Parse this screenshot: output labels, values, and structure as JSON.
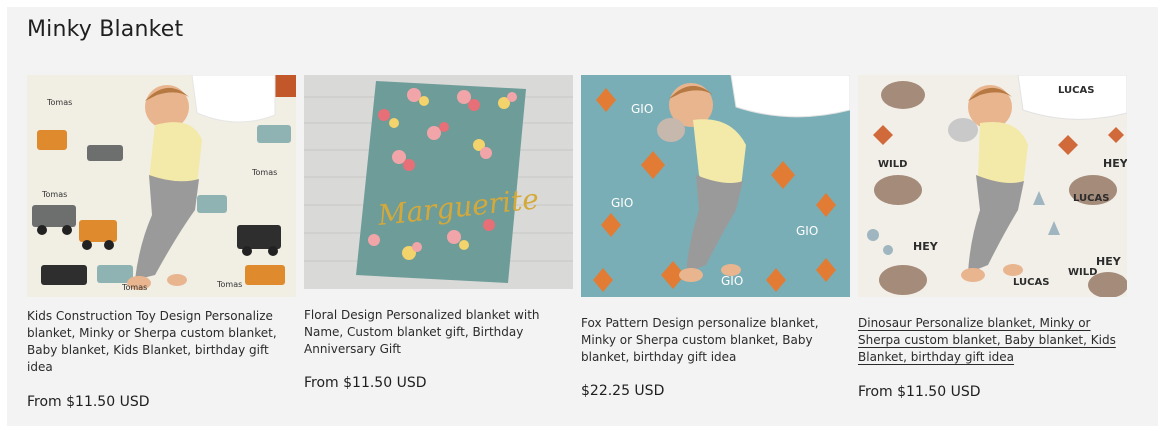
{
  "section": {
    "title": "Minky Blanket"
  },
  "products": [
    {
      "image_alt": "Kids Construction Toy Design blanket with sleeping boy",
      "title": "Kids Construction Toy Design Personalize blanket, Minky or Sherpa custom blanket, Baby blanket, Kids Blanket, birthday gift idea",
      "price": "From $11.50 USD",
      "pattern_name": "Tomas"
    },
    {
      "image_alt": "Floral Design blanket with name on wooden floor",
      "title": "Floral Design Personalized blanket with Name, Custom blanket gift, Birthday Anniversary Gift",
      "price": "From $11.50 USD",
      "pattern_name": "Marguerite"
    },
    {
      "image_alt": "Fox Pattern Design blanket with sleeping boy",
      "title": "Fox Pattern Design personalize blanket, Minky or Sherpa custom blanket, Baby blanket, birthday gift idea",
      "price": "$22.25 USD",
      "pattern_name": "GIO"
    },
    {
      "image_alt": "Dinosaur Personalize blanket with sleeping boy",
      "title": "Dinosaur Personalize blanket, Minky or Sherpa custom blanket, Baby blanket, Kids Blanket, birthday gift idea",
      "price": "From $11.50 USD",
      "pattern_name": "LUCAS",
      "pattern_words": [
        "HEY",
        "WILD"
      ]
    }
  ],
  "colors": {
    "section_bg": "#f3f3f3",
    "fox_blanket": "#79aeb6",
    "floral_blanket": "#6e9c98",
    "construction_bg": "#f1eee4",
    "woodland_bg": "#f2efe8"
  }
}
